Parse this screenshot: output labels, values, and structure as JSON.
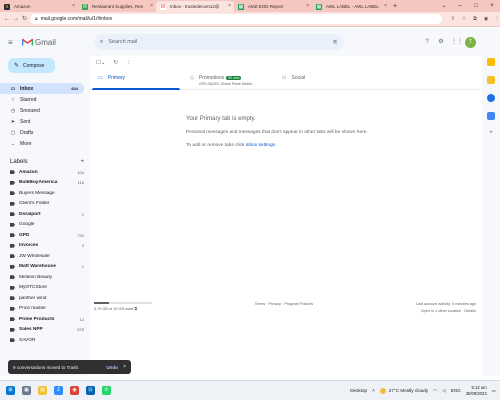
{
  "browser": {
    "tabs": [
      {
        "label": "Amazon",
        "active": false
      },
      {
        "label": "Restaurant Supplies, Res",
        "active": false
      },
      {
        "label": "Inbox - trustedecom12@",
        "active": true
      },
      {
        "label": "AMZ EOD Report",
        "active": false
      },
      {
        "label": "AWL LABEL - AWL LABEL",
        "active": false
      }
    ],
    "url": "mail.google.com/mail/u/1/#inbox"
  },
  "gmail": {
    "logo_text": "Gmail",
    "search_placeholder": "Search mail",
    "compose_label": "Compose",
    "avatar_initial": "T"
  },
  "nav": {
    "items": [
      {
        "label": "Inbox",
        "count": "604",
        "active": true
      },
      {
        "label": "Starred",
        "count": "",
        "active": false
      },
      {
        "label": "Snoozed",
        "count": "",
        "active": false
      },
      {
        "label": "Sent",
        "count": "",
        "active": false
      },
      {
        "label": "Drafts",
        "count": "",
        "active": false
      },
      {
        "label": "More",
        "count": "",
        "active": false
      }
    ],
    "labels_heading": "Labels",
    "labels": [
      {
        "label": "Amazon",
        "count": "104",
        "bold": true
      },
      {
        "label": "BulkBuyAmerica",
        "count": "116",
        "bold": true
      },
      {
        "label": "Buyers Message",
        "count": "",
        "bold": false
      },
      {
        "label": "Client's Folder",
        "count": "",
        "bold": false
      },
      {
        "label": "Doralport",
        "count": "1",
        "bold": true
      },
      {
        "label": "Google",
        "count": "",
        "bold": false
      },
      {
        "label": "GPD",
        "count": "792",
        "bold": true
      },
      {
        "label": "Invoices",
        "count": "3",
        "bold": true
      },
      {
        "label": "JW Wholesale",
        "count": "",
        "bold": false
      },
      {
        "label": "Matt Warehouse",
        "count": "1",
        "bold": true
      },
      {
        "label": "Melanin Beauty",
        "count": "",
        "bold": false
      },
      {
        "label": "MyOTCStore",
        "count": "",
        "bold": false
      },
      {
        "label": "panther wind",
        "count": "",
        "bold": false
      },
      {
        "label": "Price master",
        "count": "",
        "bold": false
      },
      {
        "label": "Prime Products",
        "count": "12",
        "bold": true
      },
      {
        "label": "Sales NPP",
        "count": "675",
        "bold": true
      },
      {
        "label": "SAVOR",
        "count": "",
        "bold": false
      }
    ]
  },
  "tabs_row": {
    "primary": "Primary",
    "promotions": "Promotions",
    "promotions_badge": "50 new",
    "promotions_snippet": "GPD SALES, Global Prime Distrib...",
    "social": "Social"
  },
  "empty_state": {
    "line1": "Your Primary tab is empty.",
    "line2": "Personal messages and messages that don't appear in other tabs will be shown here.",
    "line3_prefix": "To add or remove tabs click ",
    "line3_link": "inbox settings",
    "line3_suffix": "."
  },
  "footer": {
    "storage": "3.79 GB of 15 GB used",
    "storage_fraction": 0.25,
    "links": "Terms · Privacy · Program Policies",
    "activity": "Last account activity: 0 minutes ago",
    "activity_detail": "Open in 1 other location · Details"
  },
  "snackbar": {
    "message": "9 conversations moved to Trash.",
    "undo": "Undo"
  },
  "taskbar": {
    "desktop": "Desktop",
    "weather": "27°C  Mostly cloudy",
    "lang": "ENG",
    "time": "5:12 am",
    "date": "30/09/2023"
  }
}
